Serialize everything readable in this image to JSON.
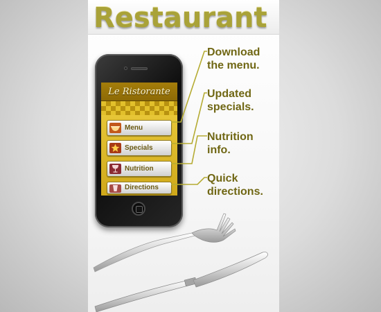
{
  "page": {
    "title": "Restaurant"
  },
  "phone_app": {
    "title": "Le Ristorante",
    "buttons": [
      {
        "label": "Menu",
        "icon": "bowl-icon"
      },
      {
        "label": "Specials",
        "icon": "star-icon"
      },
      {
        "label": "Nutrition",
        "icon": "wine-glass-icon"
      },
      {
        "label": "Directions",
        "icon": "glass-icon"
      }
    ]
  },
  "callouts": [
    {
      "line1": "Download",
      "line2": "the menu."
    },
    {
      "line1": "Updated",
      "line2": "specials."
    },
    {
      "line1": "Nutrition",
      "line2": "info."
    },
    {
      "line1": "Quick",
      "line2": "directions."
    }
  ],
  "colors": {
    "accent": "#a9a238",
    "callout_text": "#706714",
    "app_gold": "#d8b21e",
    "app_header": "#8d6a06"
  }
}
